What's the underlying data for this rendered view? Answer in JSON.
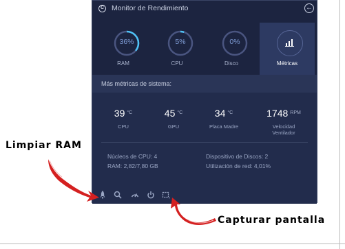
{
  "window": {
    "title": "Monitor de Rendimiento"
  },
  "tabs": [
    {
      "label": "RAM",
      "value": "36%",
      "percent": 36
    },
    {
      "label": "CPU",
      "value": "5%",
      "percent": 5
    },
    {
      "label": "Disco",
      "value": "0%",
      "percent": 0
    },
    {
      "label": "Métricas",
      "active": true,
      "icon": "bar-chart-icon"
    }
  ],
  "section": {
    "title": "Más métricas de sistema:"
  },
  "stats": [
    {
      "value": "39",
      "unit": "°C",
      "label": "CPU"
    },
    {
      "value": "45",
      "unit": "°C",
      "label": "GPU"
    },
    {
      "value": "34",
      "unit": "°C",
      "label": "Placa Madre"
    },
    {
      "value": "1748",
      "unit": "RPM",
      "label": "Velocidad Ventilador"
    }
  ],
  "info": {
    "cpu_cores": "Núcleos de CPU: 4",
    "ram": "RAM: 2,82/7,80 GB",
    "disk_devices": "Dispositivo de Discos: 2",
    "net_usage": "Utilización de red: 4,01%"
  },
  "toolbar": [
    "rocket-icon",
    "search-icon",
    "gauge-icon",
    "power-icon",
    "screenshot-icon"
  ],
  "annotations": {
    "clean_ram": "Limpiar RAM",
    "capture_screen": "Capturar pantalla"
  },
  "colors": {
    "accent": "#4fc3f7",
    "panel": "#1c2440",
    "active_tab": "#2d3a62",
    "arrow": "#d42020"
  }
}
